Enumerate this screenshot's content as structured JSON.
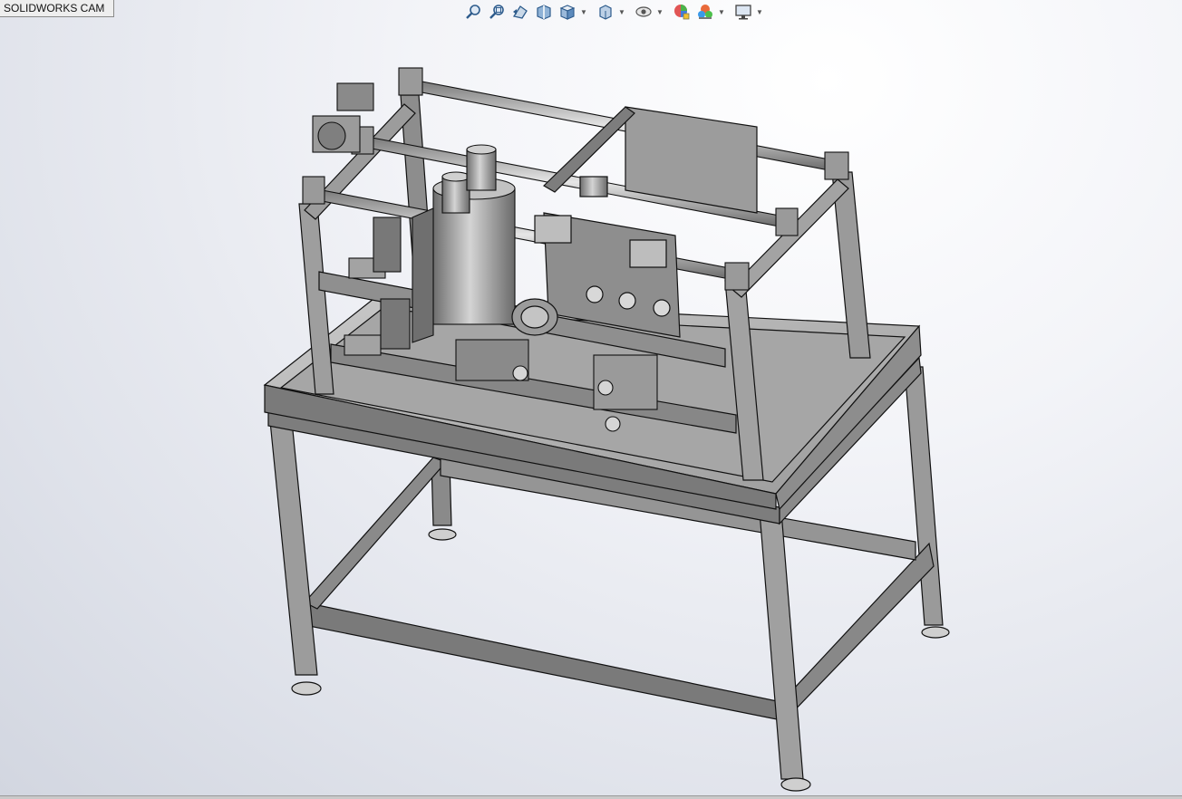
{
  "app": {
    "tab_label": "SOLIDWORKS CAM"
  },
  "toolbar": {
    "buttons": [
      {
        "icon": "zoom-to-fit-icon"
      },
      {
        "icon": "zoom-to-area-icon"
      },
      {
        "icon": "previous-view-icon"
      },
      {
        "icon": "section-view-icon"
      },
      {
        "icon": "view-orientation-icon",
        "dropdown": true
      },
      {
        "icon": "display-style-icon",
        "dropdown": true
      },
      {
        "icon": "hide-show-items-icon",
        "dropdown": true
      },
      {
        "icon": "edit-appearance-icon"
      },
      {
        "icon": "apply-scene-icon",
        "dropdown": true
      },
      {
        "icon": "view-settings-icon",
        "dropdown": true
      }
    ]
  },
  "model": {
    "name_icon": "machine-assembly-3d",
    "colors": {
      "metal_light": "#b9b9b9",
      "metal_mid": "#8e8e8e",
      "metal_dark": "#5b5b5b",
      "edge": "#111111"
    }
  }
}
